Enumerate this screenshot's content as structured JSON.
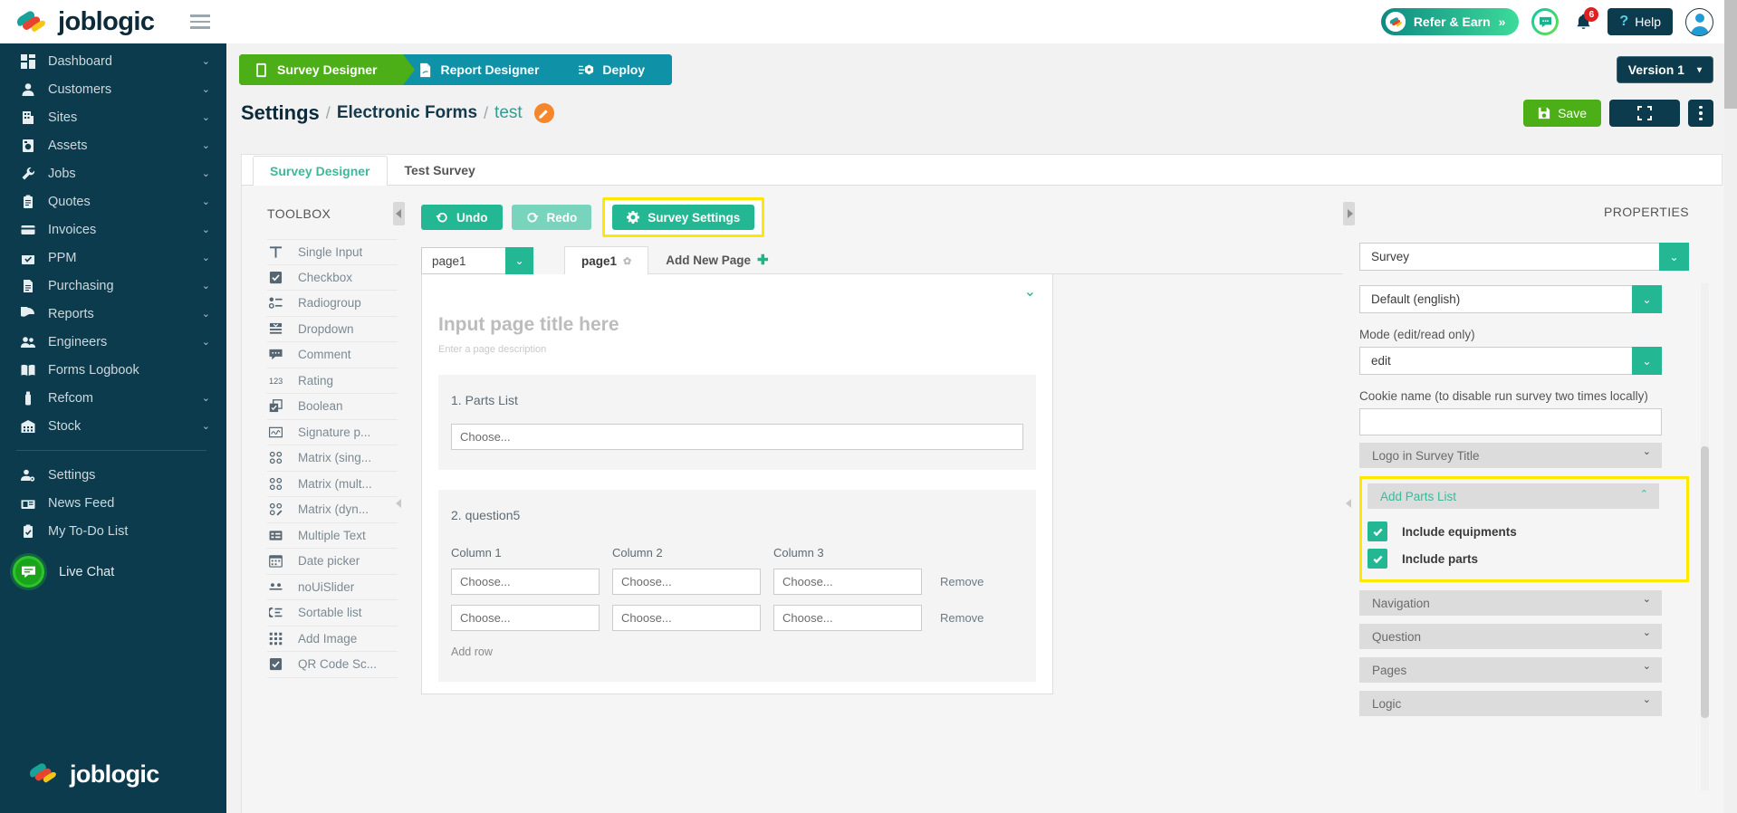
{
  "brand": {
    "name": "joblogic"
  },
  "sidebar": {
    "items": [
      {
        "label": "Dashboard",
        "icon": "dashboard-icon",
        "caret": true
      },
      {
        "label": "Customers",
        "icon": "person-icon",
        "caret": true
      },
      {
        "label": "Sites",
        "icon": "building-icon",
        "caret": true
      },
      {
        "label": "Assets",
        "icon": "asset-icon",
        "caret": true
      },
      {
        "label": "Jobs",
        "icon": "wrench-icon",
        "caret": true
      },
      {
        "label": "Quotes",
        "icon": "clipboard-icon",
        "caret": true
      },
      {
        "label": "Invoices",
        "icon": "card-icon",
        "caret": true
      },
      {
        "label": "PPM",
        "icon": "calendar-check-icon",
        "caret": true
      },
      {
        "label": "Purchasing",
        "icon": "document-icon",
        "caret": true
      },
      {
        "label": "Reports",
        "icon": "pie-chart-icon",
        "caret": true
      },
      {
        "label": "Engineers",
        "icon": "people-icon",
        "caret": true
      },
      {
        "label": "Forms Logbook",
        "icon": "book-icon",
        "caret": false
      },
      {
        "label": "Refcom",
        "icon": "cylinder-icon",
        "caret": true
      },
      {
        "label": "Stock",
        "icon": "warehouse-icon",
        "caret": true
      }
    ],
    "secondary": [
      {
        "label": "Settings",
        "icon": "user-gear-icon",
        "caret": false
      },
      {
        "label": "News Feed",
        "icon": "news-icon",
        "caret": false
      },
      {
        "label": "My To-Do List",
        "icon": "todo-icon",
        "caret": false
      }
    ],
    "live_chat": {
      "label": "Live Chat",
      "icon": "chat-bubble-icon"
    }
  },
  "topbar": {
    "refer_label": "Refer & Earn",
    "refer_chevrons": "»",
    "chat_icon": "chat-dots-icon",
    "bell_icon": "bell-icon",
    "notification_count": "6",
    "help_label": "Help",
    "help_question": "?",
    "avatar": "user-avatar"
  },
  "wizard": {
    "steps": [
      {
        "label": "Survey Designer",
        "icon": "tablet-icon",
        "state": "active"
      },
      {
        "label": "Report Designer",
        "icon": "pdf-icon",
        "state": "teal"
      },
      {
        "label": "Deploy",
        "icon": "deploy-cube-icon",
        "state": "teal"
      }
    ],
    "version_label": "Version 1"
  },
  "page_head": {
    "crumb_1": "Settings",
    "sep": "/",
    "crumb_2": "Electronic Forms",
    "crumb_3": "test",
    "edit_icon": "pencil-icon",
    "save_label": "Save",
    "expand_icon": "fullscreen-icon",
    "kebab_icon": "more-vertical-icon"
  },
  "tabs": [
    {
      "label": "Survey Designer",
      "active": true
    },
    {
      "label": "Test Survey",
      "active": false
    }
  ],
  "toolbox": {
    "title": "TOOLBOX",
    "items": [
      {
        "label": "Single Input",
        "icon": "text-t-icon"
      },
      {
        "label": "Checkbox",
        "icon": "checkbox-icon"
      },
      {
        "label": "Radiogroup",
        "icon": "radiogroup-icon"
      },
      {
        "label": "Dropdown",
        "icon": "dropdown-icon"
      },
      {
        "label": "Comment",
        "icon": "comment-icon"
      },
      {
        "label": "Rating",
        "icon": "rating-123-icon"
      },
      {
        "label": "Boolean",
        "icon": "boolean-icon"
      },
      {
        "label": "Signature p...",
        "icon": "signature-icon"
      },
      {
        "label": "Matrix (sing...",
        "icon": "matrix-single-icon"
      },
      {
        "label": "Matrix (mult...",
        "icon": "matrix-multi-icon"
      },
      {
        "label": "Matrix (dyn...",
        "icon": "matrix-dynamic-icon"
      },
      {
        "label": "Multiple Text",
        "icon": "multiple-text-icon"
      },
      {
        "label": "Date picker",
        "icon": "calendar-icon"
      },
      {
        "label": "noUiSlider",
        "icon": "slider-icon"
      },
      {
        "label": "Sortable list",
        "icon": "sortable-list-icon"
      },
      {
        "label": "Add Image",
        "icon": "grid-image-icon"
      },
      {
        "label": "QR Code Sc...",
        "icon": "qr-checkbox-icon"
      }
    ]
  },
  "editor_toolbar": {
    "undo_label": "Undo",
    "undo_icon": "undo-icon",
    "redo_label": "Redo",
    "redo_icon": "redo-icon",
    "settings_label": "Survey Settings",
    "settings_icon": "gear-icon",
    "settings_highlighted": true,
    "highlight_color": "#ffe800"
  },
  "pagebar": {
    "selected_page": "page1",
    "page_tab": "page1",
    "page_tab_gear": "gear-icon",
    "add_page_label": "Add New Page",
    "add_page_icon": "plus-icon"
  },
  "canvas": {
    "title_placeholder": "Input page title here",
    "description_placeholder": "Enter a page description",
    "collapse_icon": "chevron-down-icon",
    "questions": [
      {
        "number": "1.",
        "title": "Parts List",
        "type": "dropdown",
        "value": "Choose..."
      },
      {
        "number": "2.",
        "title": "question5",
        "type": "matrix-dynamic",
        "columns": [
          "Column 1",
          "Column 2",
          "Column 3"
        ],
        "rows": [
          {
            "cells": [
              "Choose...",
              "Choose...",
              "Choose..."
            ],
            "remove_label": "Remove"
          },
          {
            "cells": [
              "Choose...",
              "Choose...",
              "Choose..."
            ],
            "remove_label": "Remove"
          }
        ],
        "add_row_label": "Add row"
      }
    ]
  },
  "properties": {
    "title": "PROPERTIES",
    "object_select": "Survey",
    "locale_select": "Default (english)",
    "mode_label": "Mode (edit/read only)",
    "mode_select": "edit",
    "cookie_label": "Cookie name (to disable run survey two times locally)",
    "cookie_value": "",
    "accordions_before": [
      {
        "label": "Logo in Survey Title",
        "open": false,
        "caret": "chevron-down-icon"
      }
    ],
    "parts_group": {
      "label": "Add Parts List",
      "open": true,
      "caret": "chevron-up-icon",
      "highlighted": true,
      "highlight_color": "#ffe800",
      "checkboxes": [
        {
          "label": "Include equipments",
          "checked": true
        },
        {
          "label": "Include parts",
          "checked": true
        }
      ]
    },
    "accordions_after": [
      {
        "label": "Navigation",
        "open": false,
        "caret": "chevron-down-icon"
      },
      {
        "label": "Question",
        "open": false,
        "caret": "chevron-down-icon"
      },
      {
        "label": "Pages",
        "open": false,
        "caret": "chevron-down-icon"
      },
      {
        "label": "Logic",
        "open": false,
        "caret": "chevron-down-icon"
      }
    ]
  },
  "colors": {
    "sidebar_bg": "#0c3b4d",
    "accent_green": "#4caf17",
    "accent_teal": "#23b893",
    "highlight_yellow": "#ffe800",
    "wizard_teal": "#0f91a8",
    "link_teal": "#3cb89b"
  }
}
